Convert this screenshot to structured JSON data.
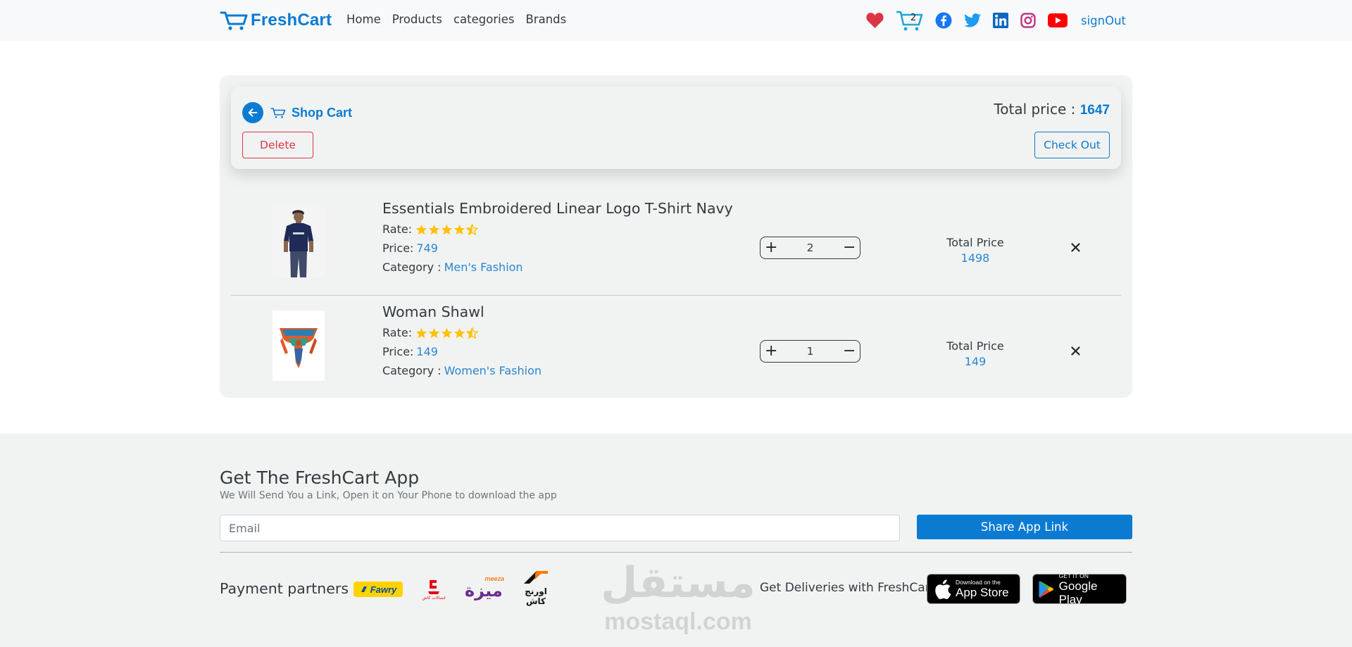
{
  "navbar": {
    "brand": "FreshCart",
    "links": [
      "Home",
      "Products",
      "categories",
      "Brands"
    ],
    "cart_count": "2",
    "signout": "signOut"
  },
  "cart": {
    "title": "Shop Cart",
    "total_label": "Total price :",
    "total_value": "1647",
    "delete_label": "Delete",
    "checkout_label": "Check Out",
    "items": [
      {
        "title": "Essentials Embroidered Linear Logo T-Shirt Navy",
        "rate_label": "Rate:",
        "rating": 4.5,
        "price_label": "Price:",
        "price": "749",
        "category_label": "Category :",
        "category": "Men's Fashion",
        "quantity": "2",
        "total_label": "Total Price",
        "total": "1498"
      },
      {
        "title": "Woman Shawl",
        "rate_label": "Rate:",
        "rating": 4.5,
        "price_label": "Price:",
        "price": "149",
        "category_label": "Category :",
        "category": "Women's Fashion",
        "quantity": "1",
        "total_label": "Total Price",
        "total": "149"
      }
    ]
  },
  "footer": {
    "app_title": "Get The FreshCart App",
    "app_subtitle": "We Will Send You a Link, Open it on Your Phone to download the app",
    "email_placeholder": "Email",
    "share_label": "Share App Link",
    "payment_label": "Payment partners",
    "partners": {
      "fawry": "Fawry",
      "meeza": "meeza",
      "meeza_ar": "ميزة",
      "orange_ar_1": "اورنج",
      "orange_ar_2": "كاش",
      "etisalat_ar": "اتصالات كاش"
    },
    "deliveries_label": "Get Deliveries with FreshCart",
    "appstore_small": "Download on the",
    "appstore_big": "App Store",
    "googleplay_small": "GET IT ON",
    "googleplay_big": "Google Play",
    "watermark_ar": "مستقل",
    "watermark": "mostaql.com"
  },
  "colors": {
    "brand": "#0b7bd2",
    "heart": "#dc3545",
    "youtube": "#ff0000",
    "facebook": "#1877f2",
    "twitter": "#1da1f2",
    "linkedin": "#0a66c2",
    "instagram": "#c13584",
    "star": "#ffc107"
  }
}
